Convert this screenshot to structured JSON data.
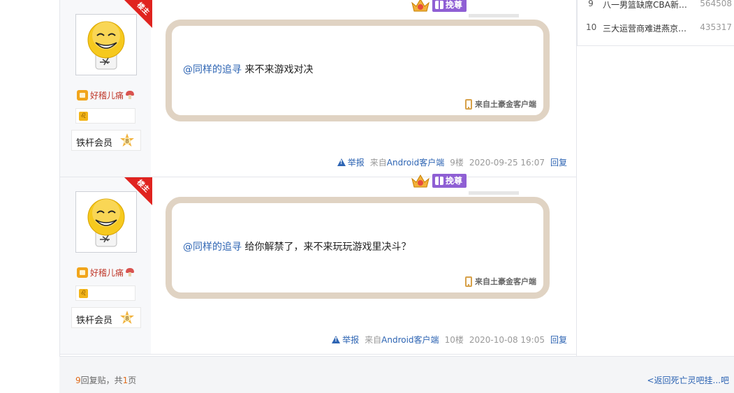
{
  "posts": [
    {
      "floor_tag": "楼主",
      "username": "好稽儿痛",
      "gender_symbol": "♌",
      "level_name": "铁杆会员",
      "level_num": "8",
      "badge_label": "挽尊",
      "content": {
        "mention": "@同样的追寻",
        "text": " 来不来游戏对决"
      },
      "client_label": "来自土豪金客户端",
      "report_label": "举报",
      "source_prefix": "来自",
      "source_app": "Android客户端",
      "floor": "9楼",
      "datetime": "2020-09-25 16:07",
      "reply_label": "回复"
    },
    {
      "floor_tag": "楼主",
      "username": "好稽儿痛",
      "gender_symbol": "♌",
      "level_name": "铁杆会员",
      "level_num": "8",
      "badge_label": "挽尊",
      "content": {
        "mention": "@同样的追寻",
        "text": " 给你解禁了，来不来玩玩游戏里决斗？"
      },
      "client_label": "来自土豪金客户端",
      "report_label": "举报",
      "source_prefix": "来自",
      "source_app": "Android客户端",
      "floor": "10楼",
      "datetime": "2020-10-08 19:05",
      "reply_label": "回复"
    }
  ],
  "footer": {
    "reply_count": "9",
    "reply_label": "回复贴，共",
    "page_count": "1",
    "page_label": "页",
    "back_link": "<返回死亡灵吧挂...吧"
  },
  "hot_list": [
    {
      "rank": "9",
      "title": "八一男篮缺席CBA新…",
      "value": "564508"
    },
    {
      "rank": "10",
      "title": "三大运营商难进燕京…",
      "value": "435317"
    }
  ],
  "colors": {
    "accent_link": "#2d64b3",
    "floor_tag_red": "#e0231f",
    "bubble_border": "#e0d3c3",
    "badge_purple": "#8f5fd4",
    "count_orange": "#e06b1a"
  }
}
